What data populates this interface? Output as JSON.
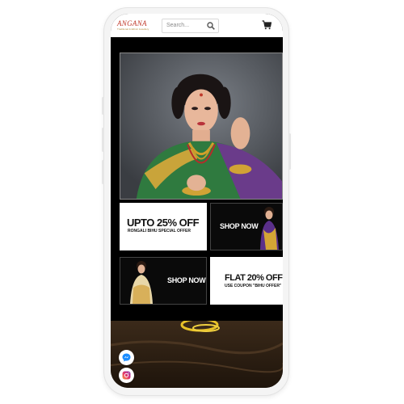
{
  "header": {
    "logo_text": "ANGANA",
    "logo_tagline": "Traditional & Ethnic Jewellery",
    "search_placeholder": "Search..."
  },
  "banners": {
    "offer1_headline": "UPTO 25% OFF",
    "offer1_sub": "RONGALI BIHU SPECIAL OFFER",
    "shop_now_1": "SHOP NOW",
    "shop_now_2": "SHOP NOW",
    "offer2_headline": "FLAT 20% OFF",
    "offer2_sub": "USE COUPON \"BIHU OFFER\""
  },
  "icons": {
    "search": "search-icon",
    "cart": "cart-icon",
    "messenger": "messenger-icon",
    "instagram": "instagram-icon"
  },
  "colors": {
    "brand": "#c0392b",
    "screen_bg": "#000000"
  }
}
